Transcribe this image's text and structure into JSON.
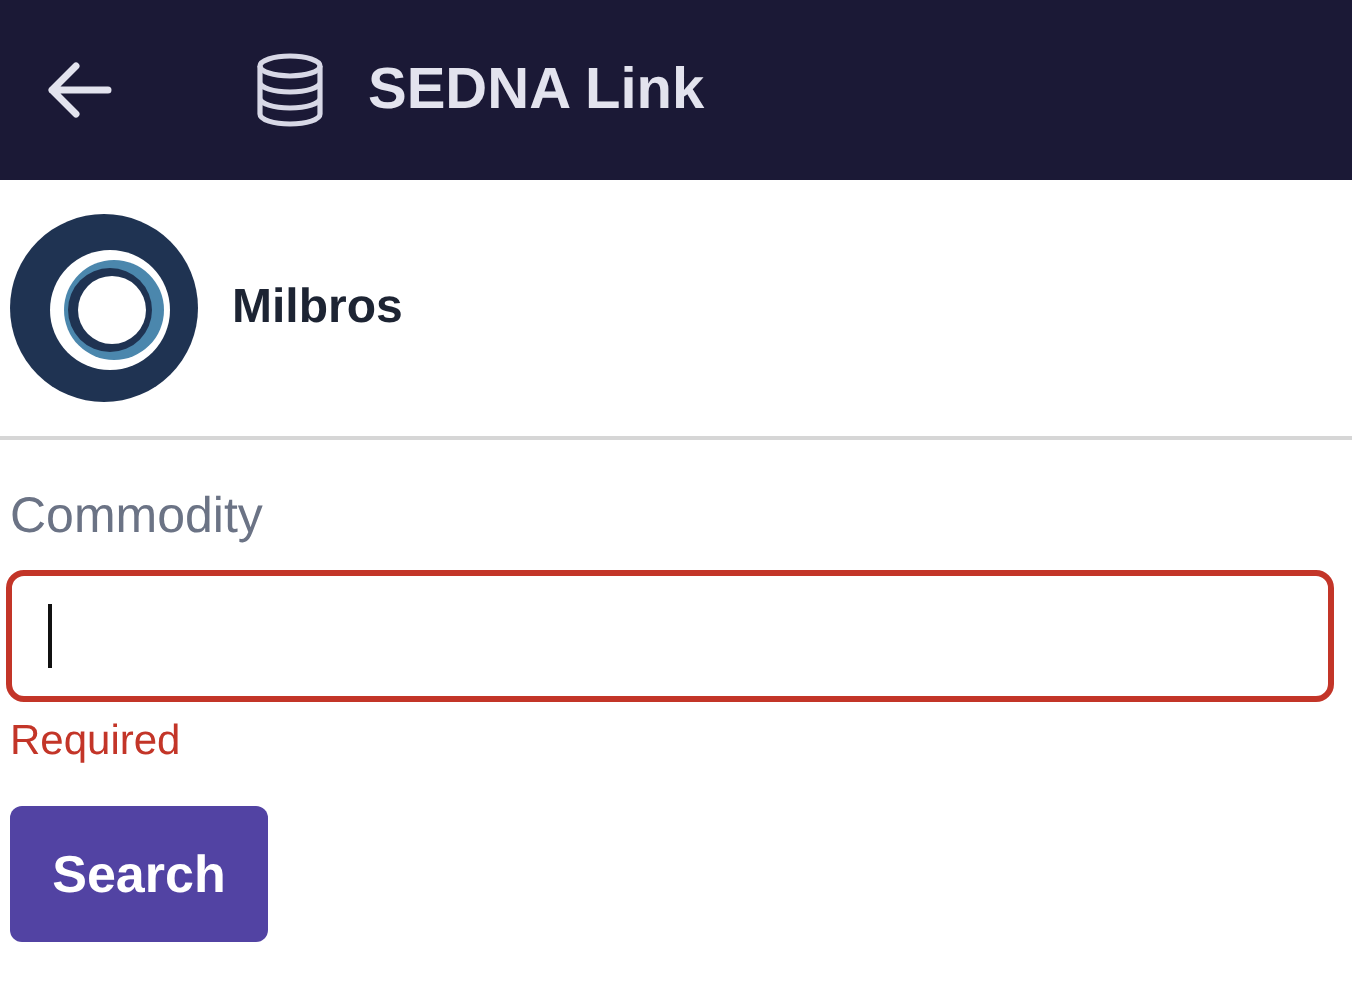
{
  "header": {
    "title": "SEDNA Link"
  },
  "company": {
    "name": "Milbros"
  },
  "field": {
    "label": "Commodity",
    "invalid": true,
    "focused": true,
    "error": "Required"
  },
  "buttons": [
    {
      "label": "Search"
    }
  ]
}
